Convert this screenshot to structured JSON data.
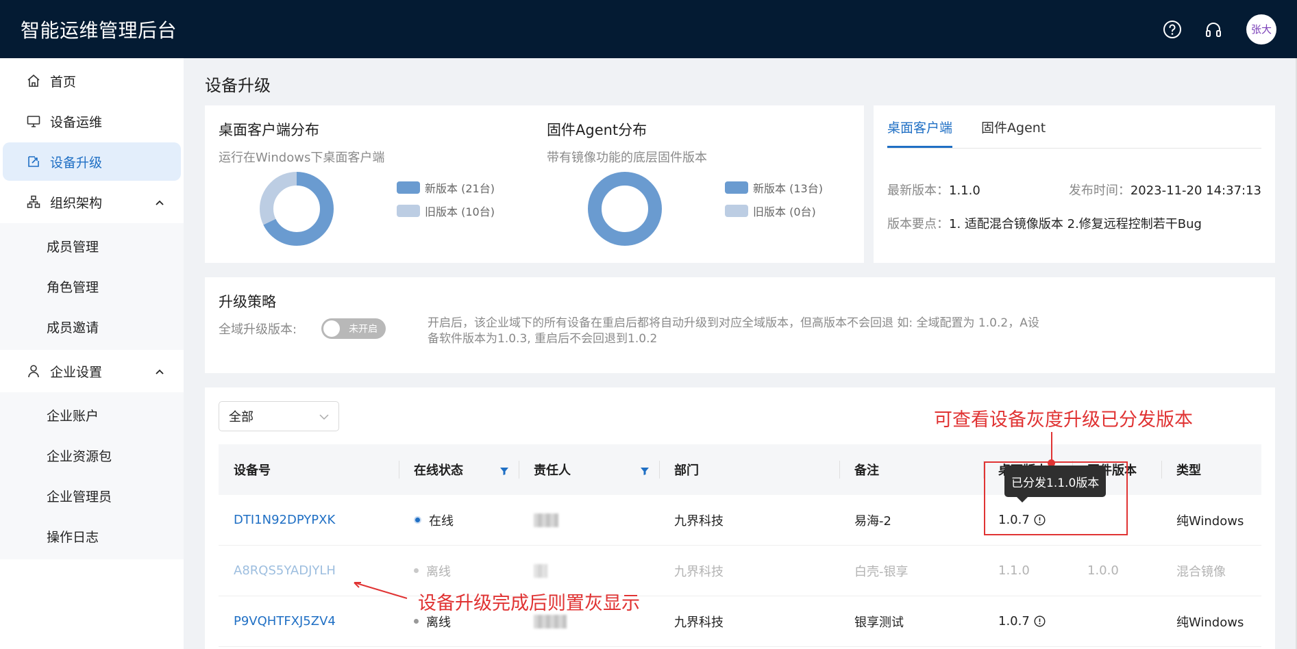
{
  "header": {
    "title": "智能运维管理后台",
    "avatar_text": "张大",
    "icons": [
      "help-icon",
      "headset-icon"
    ]
  },
  "sidebar": {
    "items": [
      {
        "label": "首页",
        "icon": "home-icon"
      },
      {
        "label": "设备运维",
        "icon": "monitor-icon"
      },
      {
        "label": "设备升级",
        "icon": "upgrade-icon",
        "active": true
      },
      {
        "label": "组织架构",
        "icon": "org-icon",
        "expanded": true,
        "children": [
          "成员管理",
          "角色管理",
          "成员邀请"
        ]
      },
      {
        "label": "企业设置",
        "icon": "user-icon",
        "expanded": true,
        "children": [
          "企业账户",
          "企业资源包",
          "企业管理员",
          "操作日志"
        ]
      }
    ]
  },
  "page": {
    "title": "设备升级"
  },
  "distribution": {
    "desktop": {
      "title": "桌面客户端分布",
      "subtitle": "运行在Windows下桌面客户端",
      "new_label": "新版本 (21台)",
      "old_label": "旧版本 (10台)",
      "new_count": 21,
      "old_count": 10
    },
    "firmware": {
      "title": "固件Agent分布",
      "subtitle": "带有镜像功能的底层固件版本",
      "new_label": "新版本 (13台)",
      "old_label": "旧版本 (0台)",
      "new_count": 13,
      "old_count": 0
    },
    "colors": {
      "new": "#6a9bd0",
      "old": "#bccde3"
    }
  },
  "version_panel": {
    "tabs": [
      "桌面客户端",
      "固件Agent"
    ],
    "latest_key": "最新版本：",
    "latest_val": "1.1.0",
    "release_key": "发布时间：",
    "release_val": "2023-11-20 14:37:13",
    "notes_key": "版本要点：",
    "notes_val": "1. 适配混合镜像版本 2.修复远程控制若干Bug"
  },
  "strategy": {
    "title": "升级策略",
    "toggle_label": "全域升级版本:",
    "toggle_state": "未开启",
    "description": "开启后，该企业域下的所有设备在重启后都将自动升级到对应全域版本，但高版本不会回退 如: 全域配置为 1.0.2，A设备软件版本为1.0.3, 重启后不会回退到1.0.2"
  },
  "table": {
    "filter_value": "全部",
    "columns": [
      "设备号",
      "在线状态",
      "责任人",
      "部门",
      "备注",
      "桌面版本",
      "固件版本",
      "类型"
    ],
    "rows": [
      {
        "device": "DTI1N92DPYPXK",
        "status": "在线",
        "online": true,
        "dept": "九界科技",
        "note": "易海-2",
        "desktop_ver": "1.0.7",
        "firmware_ver": "",
        "type": "纯Windows",
        "dim": false
      },
      {
        "device": "A8RQS5YADJYLH",
        "status": "离线",
        "online": false,
        "dept": "九界科技",
        "note": "白壳-银享",
        "desktop_ver": "1.1.0",
        "firmware_ver": "1.0.0",
        "type": "混合镜像",
        "dim": true
      },
      {
        "device": "P9VQHTFXJ5ZV4",
        "status": "离线",
        "online": false,
        "dept": "九界科技",
        "note": "银享测试",
        "desktop_ver": "1.0.7",
        "firmware_ver": "",
        "type": "纯Windows",
        "dim": false
      }
    ]
  },
  "annotations": {
    "top": "可查看设备灰度升级已分发版本",
    "bottom": "设备升级完成后则置灰显示",
    "tooltip": "已分发1.1.0版本"
  }
}
